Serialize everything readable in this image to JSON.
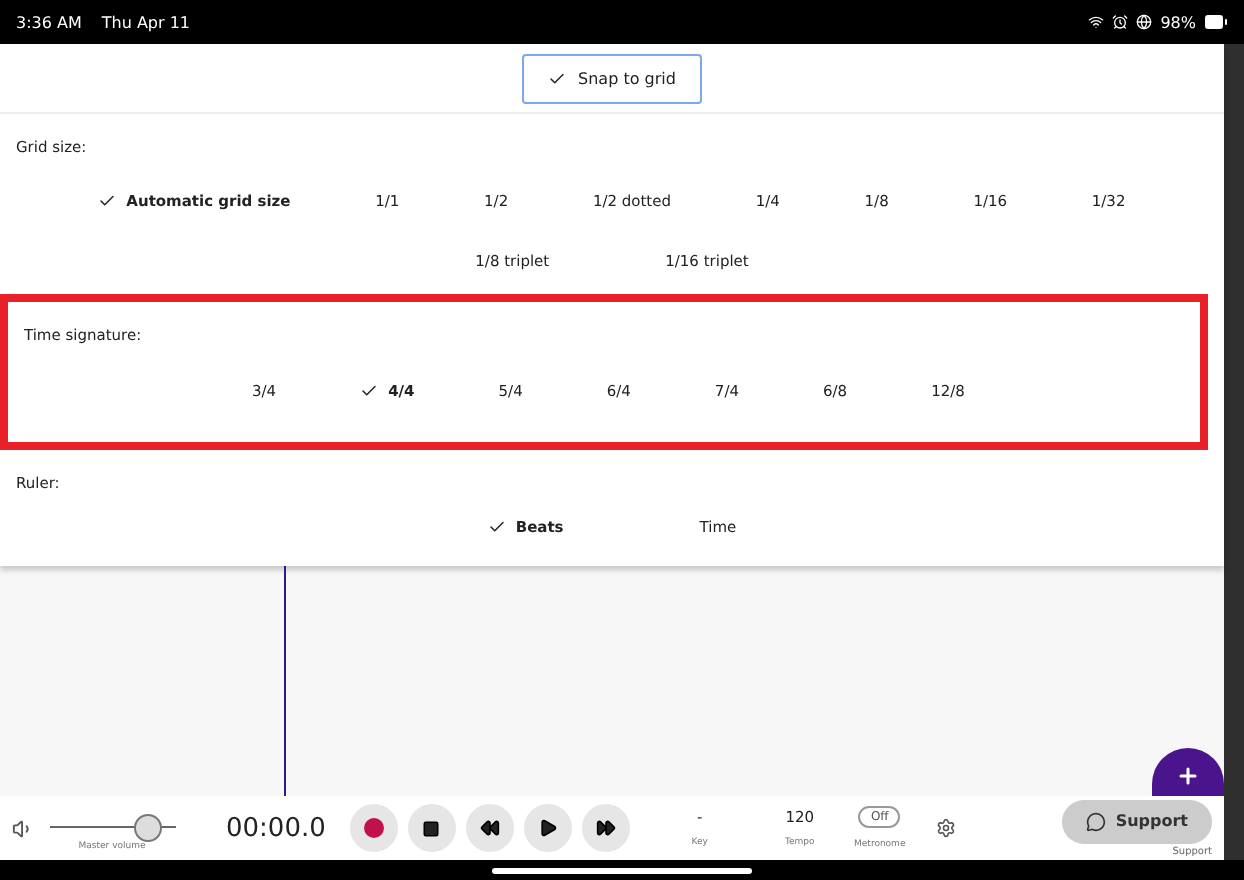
{
  "status_bar": {
    "time": "3:36 AM",
    "date": "Thu Apr 11",
    "battery": "98%"
  },
  "snap_to_grid": {
    "label": "Snap to grid",
    "checked": true
  },
  "grid_size": {
    "label": "Grid size:",
    "options": [
      {
        "label": "Automatic grid size",
        "selected": true
      },
      {
        "label": "1/1",
        "selected": false
      },
      {
        "label": "1/2",
        "selected": false
      },
      {
        "label": "1/2 dotted",
        "selected": false
      },
      {
        "label": "1/4",
        "selected": false
      },
      {
        "label": "1/8",
        "selected": false
      },
      {
        "label": "1/16",
        "selected": false
      },
      {
        "label": "1/32",
        "selected": false
      }
    ],
    "triplet_options": [
      {
        "label": "1/8 triplet",
        "selected": false
      },
      {
        "label": "1/16 triplet",
        "selected": false
      }
    ]
  },
  "time_signature": {
    "label": "Time signature:",
    "highlighted": true,
    "options": [
      {
        "label": "3/4",
        "selected": false
      },
      {
        "label": "4/4",
        "selected": true
      },
      {
        "label": "5/4",
        "selected": false
      },
      {
        "label": "6/4",
        "selected": false
      },
      {
        "label": "7/4",
        "selected": false
      },
      {
        "label": "6/8",
        "selected": false
      },
      {
        "label": "12/8",
        "selected": false
      }
    ]
  },
  "ruler": {
    "label": "Ruler:",
    "options": [
      {
        "label": "Beats",
        "selected": true
      },
      {
        "label": "Time",
        "selected": false
      }
    ]
  },
  "transport": {
    "master_volume": {
      "label": "Master volume",
      "level": 0.78
    },
    "time": "00:00.0",
    "key": {
      "value": "-",
      "label": "Key"
    },
    "tempo": {
      "value": "120",
      "label": "Tempo"
    },
    "metronome": {
      "value": "Off",
      "label": "Metronome"
    },
    "support": {
      "label": "Support",
      "caption": "Support"
    }
  }
}
